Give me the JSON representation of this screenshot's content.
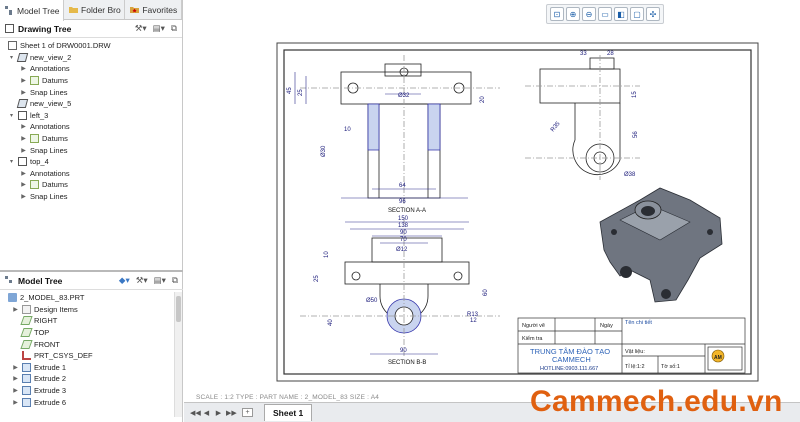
{
  "tabs": [
    {
      "label": "Model Tree"
    },
    {
      "label": "Folder Bro"
    },
    {
      "label": "Favorites"
    }
  ],
  "drawing_tree": {
    "title": "Drawing Tree",
    "items": [
      {
        "label": "Sheet 1 of DRW0001.DRW"
      },
      {
        "label": "new_view_2"
      },
      {
        "label": "Annotations"
      },
      {
        "label": "Datums"
      },
      {
        "label": "Snap Lines"
      },
      {
        "label": "new_view_5"
      },
      {
        "label": "left_3"
      },
      {
        "label": "Annotations"
      },
      {
        "label": "Datums"
      },
      {
        "label": "Snap Lines"
      },
      {
        "label": "top_4"
      },
      {
        "label": "Annotations"
      },
      {
        "label": "Datums"
      },
      {
        "label": "Snap Lines"
      }
    ]
  },
  "model_tree": {
    "title": "Model Tree",
    "items": [
      {
        "label": "2_MODEL_83.PRT"
      },
      {
        "label": "Design Items"
      },
      {
        "label": "RIGHT"
      },
      {
        "label": "TOP"
      },
      {
        "label": "FRONT"
      },
      {
        "label": "PRT_CSYS_DEF"
      },
      {
        "label": "Extrude 1"
      },
      {
        "label": "Extrude 2"
      },
      {
        "label": "Extrude 3"
      },
      {
        "label": "Extrude 6"
      }
    ]
  },
  "status": "SCALE : 1:2     TYPE : PART     NAME : 2_MODEL_83     SIZE : A4",
  "sheet_tab": "Sheet 1",
  "watermark": "Cammech.edu.vn",
  "drawing": {
    "section_aa": "SECTION A-A",
    "section_bb": "SECTION B-B",
    "title_block": {
      "nguoi_ve": "Người vẽ",
      "ngay": "Ngày",
      "kiem_tra": "Kiểm tra",
      "ten_chi_tiet": "Tên chi tiết",
      "company": "TRUNG TÂM ĐÀO TẠO",
      "company2": "CAMMECH",
      "hotline": "HOTLINE:0903.111.667",
      "vat_lieu": "Vật liệu:",
      "ti_le": "Tỉ lệ:1:2",
      "to_so": "Tờ số:1"
    },
    "dims": {
      "d150": "150",
      "d138": "138",
      "d90": "90",
      "d70": "70",
      "d64": "64",
      "d96": "96",
      "d32": "Ø32",
      "d30": "Ø30",
      "d10": "10",
      "d45": "45",
      "d25": "25",
      "d33": "33",
      "d28": "28",
      "d56": "56",
      "d38": "Ø38",
      "d35": "R35",
      "d40": "40",
      "d60": "60",
      "d12": "Ø12",
      "d50": "Ø50",
      "d90b": "90",
      "d20": "20",
      "d15": "15",
      "d12b": "12",
      "d13": "R13"
    }
  }
}
